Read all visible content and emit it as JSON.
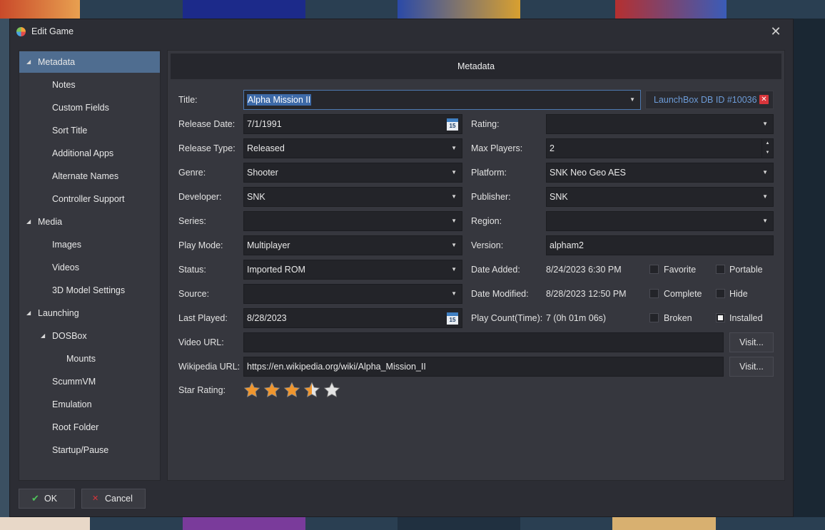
{
  "window": {
    "title": "Edit Game"
  },
  "sidebar": {
    "items": [
      {
        "label": "Metadata",
        "level": 0,
        "expanded": true,
        "selected": true
      },
      {
        "label": "Notes",
        "level": 1
      },
      {
        "label": "Custom Fields",
        "level": 1
      },
      {
        "label": "Sort Title",
        "level": 1
      },
      {
        "label": "Additional Apps",
        "level": 1
      },
      {
        "label": "Alternate Names",
        "level": 1
      },
      {
        "label": "Controller Support",
        "level": 1
      },
      {
        "label": "Media",
        "level": 0,
        "expanded": true
      },
      {
        "label": "Images",
        "level": 1
      },
      {
        "label": "Videos",
        "level": 1
      },
      {
        "label": "3D Model Settings",
        "level": 1
      },
      {
        "label": "Launching",
        "level": 0,
        "expanded": true
      },
      {
        "label": "DOSBox",
        "level": 1,
        "expanded": true
      },
      {
        "label": "Mounts",
        "level": 2
      },
      {
        "label": "ScummVM",
        "level": 1
      },
      {
        "label": "Emulation",
        "level": 1
      },
      {
        "label": "Root Folder",
        "level": 1
      },
      {
        "label": "Startup/Pause",
        "level": 1
      }
    ]
  },
  "main": {
    "header": "Metadata",
    "title": {
      "label": "Title:",
      "value": "Alpha Mission II"
    },
    "db_id": "LaunchBox DB ID #10036",
    "release_date": {
      "label": "Release Date:",
      "value": "7/1/1991"
    },
    "rating": {
      "label": "Rating:",
      "value": ""
    },
    "release_type": {
      "label": "Release Type:",
      "value": "Released"
    },
    "max_players": {
      "label": "Max Players:",
      "value": "2"
    },
    "genre": {
      "label": "Genre:",
      "value": "Shooter"
    },
    "platform": {
      "label": "Platform:",
      "value": "SNK Neo Geo AES"
    },
    "developer": {
      "label": "Developer:",
      "value": "SNK"
    },
    "publisher": {
      "label": "Publisher:",
      "value": "SNK"
    },
    "series": {
      "label": "Series:",
      "value": ""
    },
    "region": {
      "label": "Region:",
      "value": ""
    },
    "play_mode": {
      "label": "Play Mode:",
      "value": "Multiplayer"
    },
    "version": {
      "label": "Version:",
      "value": "alpham2"
    },
    "status": {
      "label": "Status:",
      "value": "Imported ROM"
    },
    "date_added": {
      "label": "Date Added:",
      "value": "8/24/2023 6:30 PM"
    },
    "source": {
      "label": "Source:",
      "value": ""
    },
    "date_modified": {
      "label": "Date Modified:",
      "value": "8/28/2023 12:50 PM"
    },
    "last_played": {
      "label": "Last Played:",
      "value": "8/28/2023"
    },
    "play_count": {
      "label": "Play Count(Time):",
      "value": "7 (0h 01m 06s)"
    },
    "video_url": {
      "label": "Video URL:",
      "value": ""
    },
    "wikipedia_url": {
      "label": "Wikipedia URL:",
      "value": "https://en.wikipedia.org/wiki/Alpha_Mission_II"
    },
    "visit_label": "Visit...",
    "star_rating": {
      "label": "Star Rating:",
      "value": 3.5,
      "max": 5
    },
    "checkboxes": {
      "favorite": {
        "label": "Favorite",
        "checked": false
      },
      "portable": {
        "label": "Portable",
        "checked": false
      },
      "complete": {
        "label": "Complete",
        "checked": false
      },
      "hide": {
        "label": "Hide",
        "checked": false
      },
      "broken": {
        "label": "Broken",
        "checked": false
      },
      "installed": {
        "label": "Installed",
        "checked": true
      }
    },
    "calendar_day": "15"
  },
  "footer": {
    "ok_label": "OK",
    "cancel_label": "Cancel"
  },
  "colors": {
    "accent": "#4f6d90",
    "link": "#6d9cd8",
    "star": "#f0962e"
  }
}
